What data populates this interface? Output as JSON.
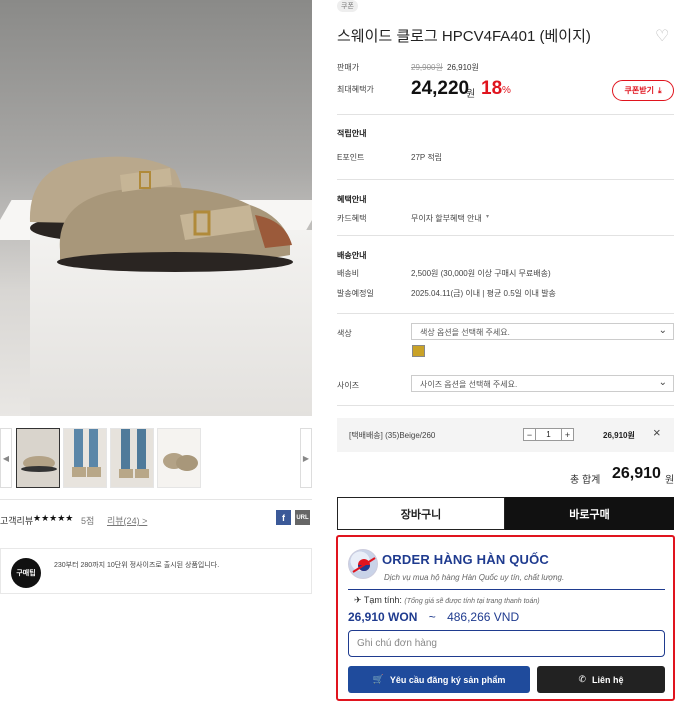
{
  "product": {
    "tag": "쿠폰",
    "title": "스웨이드 클로그 HPCV4FA401 (베이지)",
    "sale_price_label": "판매가",
    "original_price": "29,900원",
    "sale_price": "26,910원",
    "max_benefit_label": "최대혜택가",
    "benefit_price": "24,220",
    "benefit_unit": "원",
    "discount_rate": "18",
    "discount_unit": "%",
    "coupon_button": "쿠폰받기"
  },
  "points": {
    "section_title": "적립안내",
    "label": "E포인트",
    "value": "27P 적립"
  },
  "benefits": {
    "section_title": "혜택안내",
    "label": "카드혜택",
    "value": "무이자 할부혜택 안내"
  },
  "shipping": {
    "section_title": "배송안내",
    "fee_label": "배송비",
    "fee_value": "2,500원 (30,000원 이상 구매시 무료배송)",
    "date_label": "발송예정일",
    "date_value": "2025.04.11(금) 이내  |  평균 0.5일 이내 발송"
  },
  "options": {
    "color_label": "색상",
    "color_placeholder": "색상 옵션을 선택해 주세요.",
    "swatch_color": "#c9a227",
    "size_label": "사이즈",
    "size_placeholder": "사이즈 옵션을 선택해 주세요."
  },
  "selected_option": {
    "name": "[택배배송] (35)Beige/260",
    "quantity": "1",
    "price": "26,910원"
  },
  "total": {
    "label": "총 합계",
    "amount": "26,910",
    "unit": "원"
  },
  "buttons": {
    "cart": "장바구니",
    "buy": "바로구매"
  },
  "review": {
    "label": "고객리뷰",
    "stars": "★★★★★",
    "score": "5점",
    "count_link": "리뷰(24) >",
    "fb": "f",
    "url": "URL"
  },
  "notice": {
    "badge": "구매팁",
    "text": "230부터 280까지 10단위 정사이즈로 출시된 상품입니다."
  },
  "order_widget": {
    "title": "ORDER HÀNG HÀN QUỐC",
    "subtitle": "Dịch vụ mua hộ hàng Hàn Quốc uy tín, chất lượng.",
    "estimate_label": "Tạm tính:",
    "estimate_note": "(Tổng giá sẽ được tính tại trang thanh toán)",
    "price_won": "26,910 WON",
    "tilde": "~",
    "price_vnd": "486,266 VND",
    "note_placeholder": "Ghi chú đơn hàng",
    "request_button": "Yêu cầu đăng ký sản phẩm",
    "contact_button": "Liên hệ",
    "accent": "#1f3b8f",
    "border": "#e0141e"
  }
}
